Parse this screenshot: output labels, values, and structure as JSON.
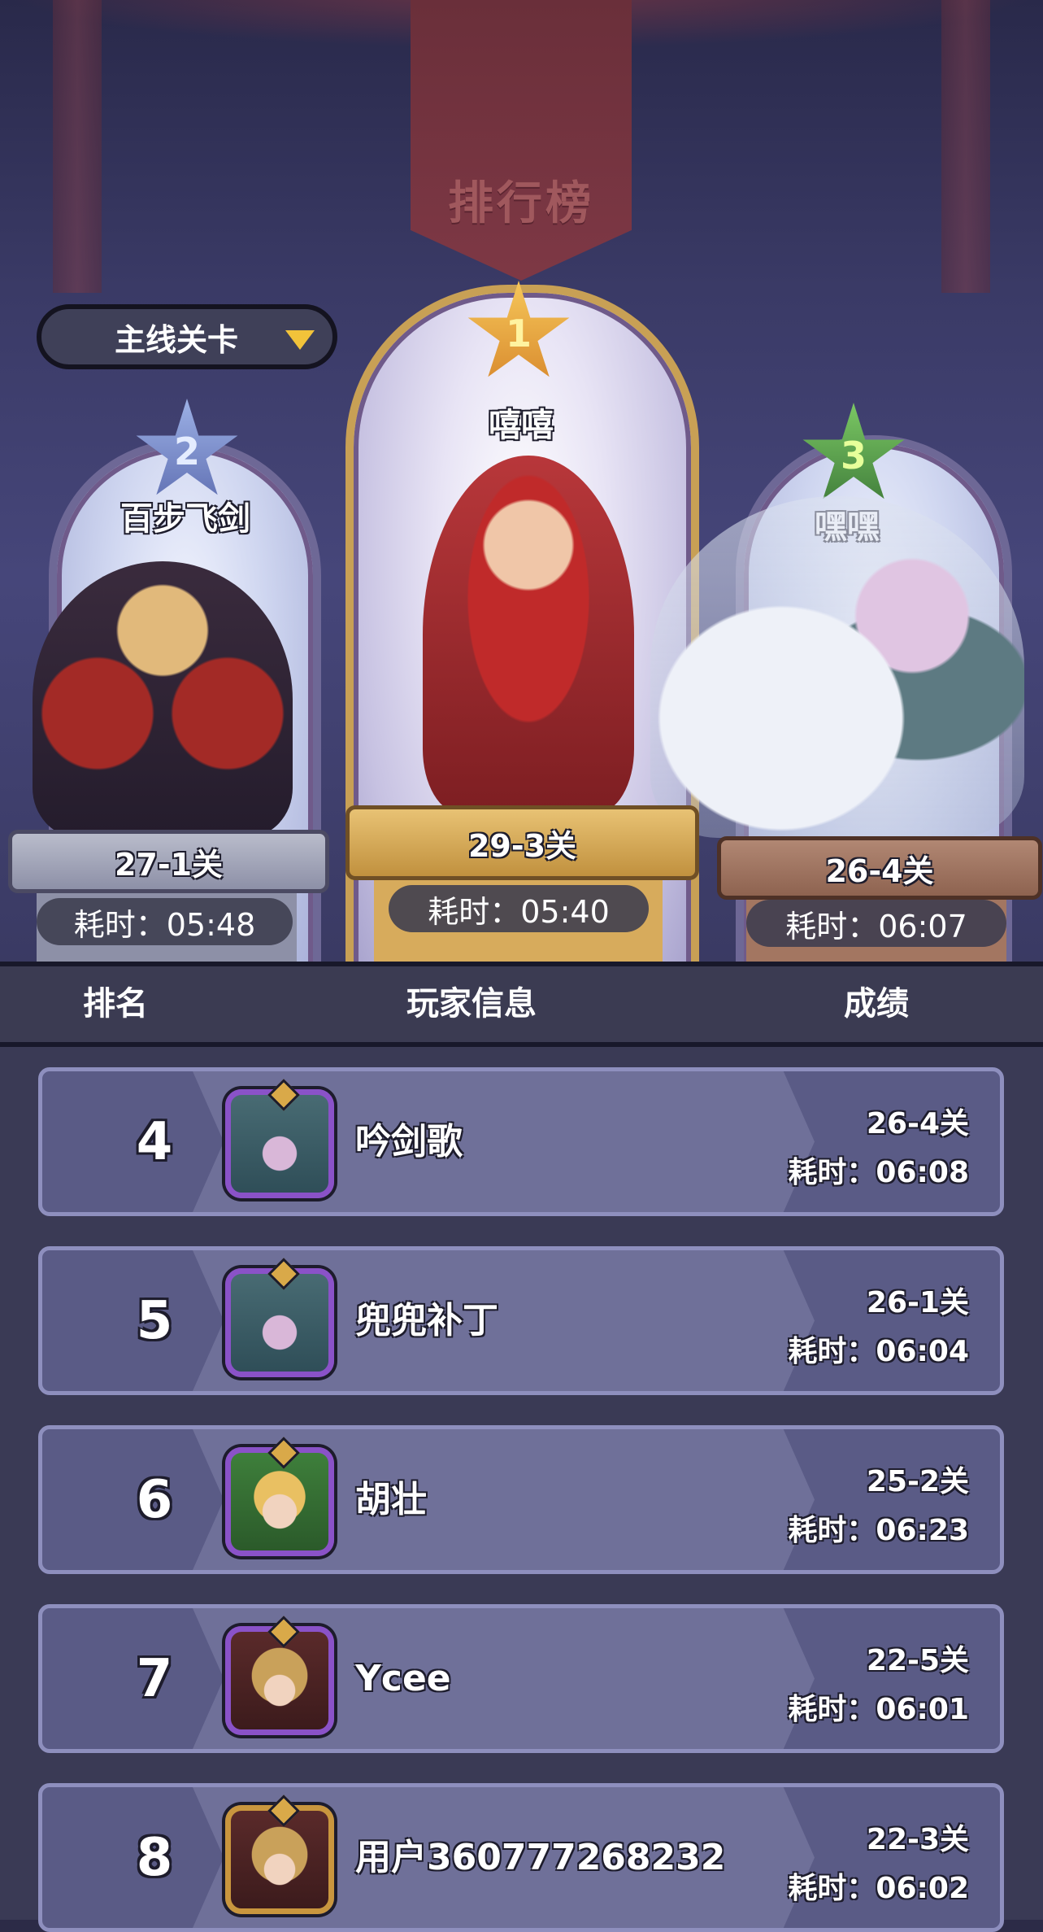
{
  "title": "排行榜",
  "dropdown": {
    "selected": "主线关卡"
  },
  "podium": [
    {
      "rank": "1",
      "name": "嘻嘻",
      "stage": "29-3关",
      "time": "耗时：05:40"
    },
    {
      "rank": "2",
      "name": "百步飞剑",
      "stage": "27-1关",
      "time": "耗时：05:48"
    },
    {
      "rank": "3",
      "name": "嘿嘿",
      "stage": "26-4关",
      "time": "耗时：06:07"
    }
  ],
  "table": {
    "headers": {
      "rank": "排名",
      "player": "玩家信息",
      "score": "成绩"
    },
    "rows": [
      {
        "rank": "4",
        "name": "吟剑歌",
        "stage": "26-4关",
        "time": "耗时：06:08"
      },
      {
        "rank": "5",
        "name": "兜兜补丁",
        "stage": "26-1关",
        "time": "耗时：06:04"
      },
      {
        "rank": "6",
        "name": "胡壮",
        "stage": "25-2关",
        "time": "耗时：06:23"
      },
      {
        "rank": "7",
        "name": "Ycee",
        "stage": "22-5关",
        "time": "耗时：06:01"
      },
      {
        "rank": "8",
        "name": "用户360777268232",
        "stage": "22-3关",
        "time": "耗时：06:02"
      }
    ]
  },
  "colors": {
    "gold": "#c8a055",
    "silver": "#8d90a7",
    "bronze": "#a37661",
    "row_bg": "#5a5b86",
    "dropdown_arrow": "#f2c33a"
  }
}
